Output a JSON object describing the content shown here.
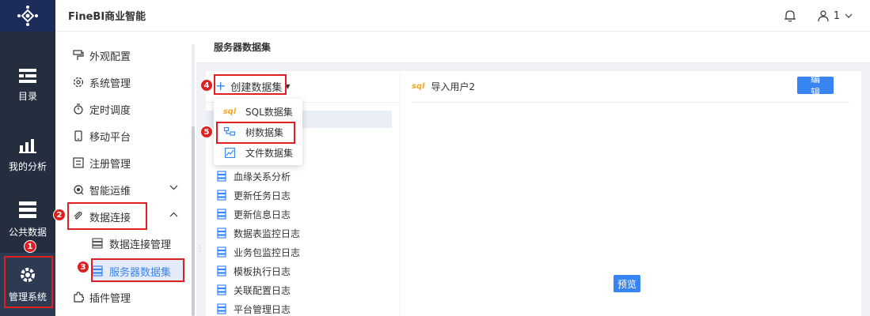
{
  "app": {
    "title": "FineBI商业智能"
  },
  "header": {
    "user_name": "1"
  },
  "rail": [
    {
      "label": "目录",
      "icon": "catalog-icon"
    },
    {
      "label": "我的分析",
      "icon": "analysis-icon"
    },
    {
      "label": "公共数据",
      "icon": "public-data-icon"
    },
    {
      "label": "管理系统",
      "icon": "management-gear-icon"
    }
  ],
  "submenu": {
    "items": [
      {
        "label": "外观配置",
        "icon": "paint-icon"
      },
      {
        "label": "系统管理",
        "icon": "settings-icon"
      },
      {
        "label": "定时调度",
        "icon": "timer-icon"
      },
      {
        "label": "移动平台",
        "icon": "mobile-icon"
      },
      {
        "label": "注册管理",
        "icon": "register-icon"
      },
      {
        "label": "智能运维",
        "icon": "ops-icon"
      },
      {
        "label": "数据连接",
        "icon": "link-icon"
      },
      {
        "label": "插件管理",
        "icon": "plugin-icon"
      }
    ],
    "children": [
      {
        "label": "数据连接管理"
      },
      {
        "label": "服务器数据集"
      }
    ]
  },
  "content": {
    "title": "服务器数据集",
    "create_label": "创建数据集",
    "dropdown": [
      {
        "label": "SQL数据集",
        "icon": "sql-icon"
      },
      {
        "label": "树数据集",
        "icon": "tree-icon"
      },
      {
        "label": "文件数据集",
        "icon": "file-chart-icon"
      }
    ],
    "dataset_list": [
      "血缘关系分析",
      "更新任务日志",
      "更新信息日志",
      "数据表监控日志",
      "业务包监控日志",
      "模板执行日志",
      "关联配置日志",
      "平台管理日志"
    ],
    "detail": {
      "sql_tag": "sql",
      "name": "导入用户2",
      "edit_label": "编辑",
      "preview_label": "预览"
    }
  },
  "annotations": [
    "1",
    "2",
    "3",
    "4",
    "5"
  ],
  "colors": {
    "accent": "#3685f2",
    "rail_bg": "#242e3f",
    "annotation": "#e02020",
    "sql_orange": "#f5a623"
  }
}
